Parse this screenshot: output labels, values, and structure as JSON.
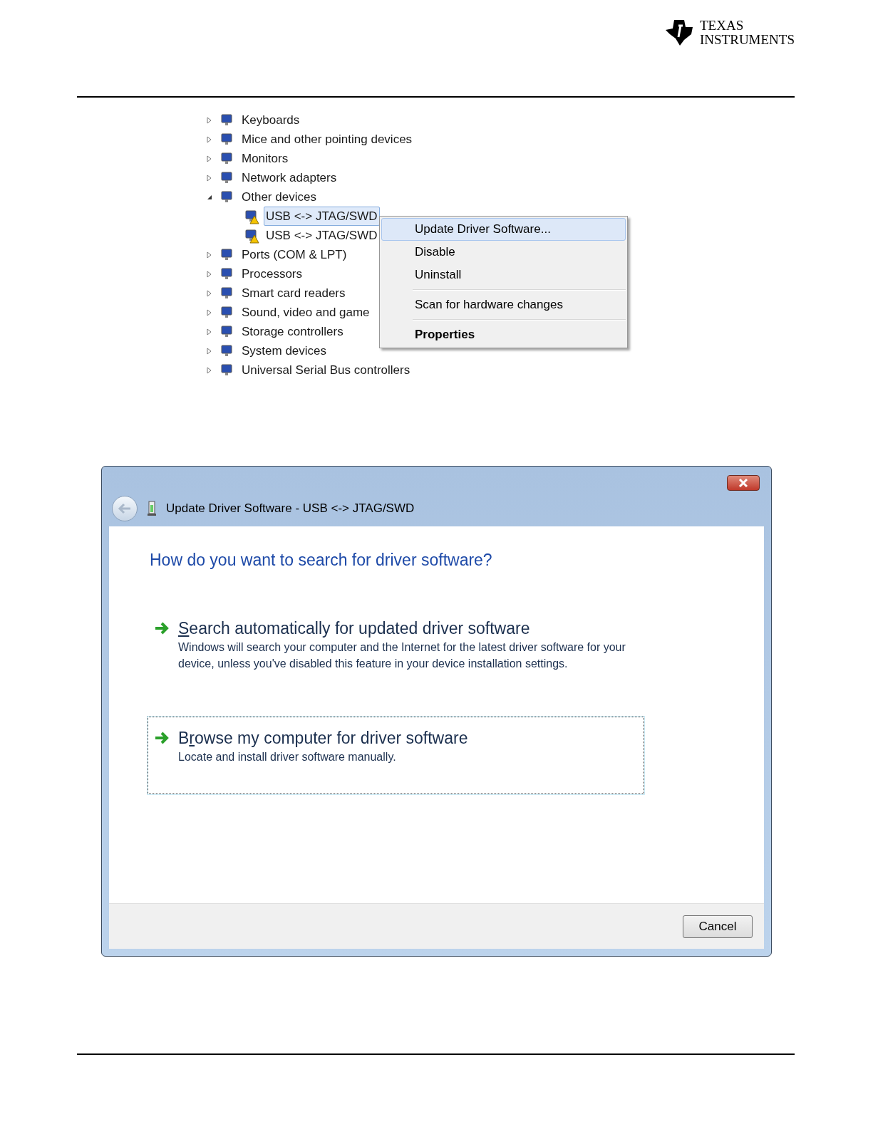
{
  "header": {
    "logo_line1": "TEXAS",
    "logo_line2": "INSTRUMENTS"
  },
  "device_tree": [
    {
      "label": "Keyboards",
      "expanded": false
    },
    {
      "label": "Mice and other pointing devices",
      "expanded": false
    },
    {
      "label": "Monitors",
      "expanded": false
    },
    {
      "label": "Network adapters",
      "expanded": false
    },
    {
      "label": "Other devices",
      "expanded": true,
      "children": [
        {
          "label": "USB <-> JTAG/SWD",
          "selected": true
        },
        {
          "label": "USB <-> JTAG/SWD",
          "selected": false
        }
      ]
    },
    {
      "label": "Ports (COM & LPT)",
      "expanded": false
    },
    {
      "label": "Processors",
      "expanded": false
    },
    {
      "label": "Smart card readers",
      "expanded": false
    },
    {
      "label": "Sound, video and game",
      "expanded": false
    },
    {
      "label": "Storage controllers",
      "expanded": false
    },
    {
      "label": "System devices",
      "expanded": false
    },
    {
      "label": "Universal Serial Bus controllers",
      "expanded": false
    }
  ],
  "context_menu": [
    {
      "kind": "item",
      "label": "Update Driver Software...",
      "selected": true,
      "default": false
    },
    {
      "kind": "item",
      "label": "Disable",
      "selected": false,
      "default": false
    },
    {
      "kind": "item",
      "label": "Uninstall",
      "selected": false,
      "default": false
    },
    {
      "kind": "separator"
    },
    {
      "kind": "item",
      "label": "Scan for hardware changes",
      "selected": false,
      "default": false
    },
    {
      "kind": "separator"
    },
    {
      "kind": "item",
      "label": "Properties",
      "selected": false,
      "default": true
    }
  ],
  "dialog": {
    "title": "Update Driver Software - USB <-> JTAG/SWD",
    "heading": "How do you want to search for driver software?",
    "options": [
      {
        "key": "S",
        "after": "earch automatically for updated driver software",
        "description": "Windows will search your computer and the Internet for the latest driver software for your device, unless you've disabled this feature in your device installation settings.",
        "focused": false
      },
      {
        "before": "B",
        "key": "r",
        "after": "owse my computer for driver software",
        "description": "Locate and install driver software manually.",
        "focused": true
      }
    ],
    "cancel_button": "Cancel"
  }
}
